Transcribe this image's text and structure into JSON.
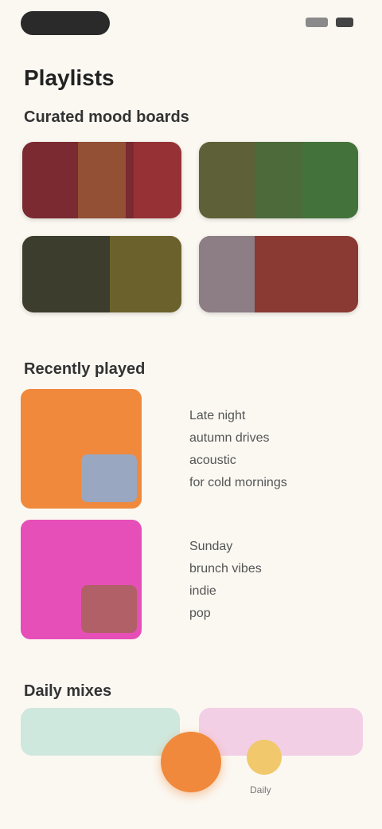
{
  "header": {
    "title": "Playlists"
  },
  "sections": {
    "featured": {
      "title": "Curated mood boards",
      "cards": [
        {
          "label": "",
          "color": "#7a2a30"
        },
        {
          "label": "",
          "color": "#4d6a3a"
        },
        {
          "label": "",
          "color": "#3d3d2e"
        },
        {
          "label": "",
          "color": "#8a3a32"
        }
      ]
    },
    "recent": {
      "title": "Recently played",
      "items": [
        {
          "lines": [
            "Late night",
            "autumn drives",
            "acoustic",
            "for cold mornings"
          ],
          "color": "#f0893c"
        },
        {
          "lines": [
            "Sunday",
            "brunch vibes",
            "indie",
            "pop"
          ],
          "color": "#e64fb8"
        }
      ]
    },
    "mixes": {
      "title": "Daily mixes",
      "now_playing": "Daily"
    }
  },
  "colors": {
    "background": "#fbf8f2",
    "accent": "#f0893c",
    "pink": "#e64fb8"
  }
}
